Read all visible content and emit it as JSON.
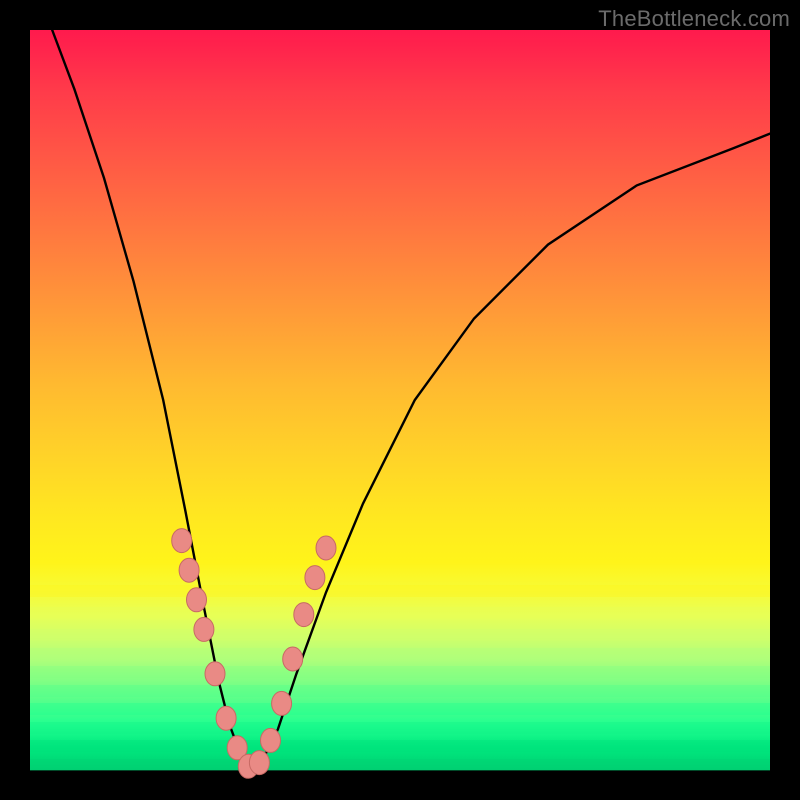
{
  "watermark": "TheBottleneck.com",
  "colors": {
    "frame": "#000000",
    "curve": "#000000",
    "marker_fill": "#e98a85",
    "marker_stroke": "#c76a64"
  },
  "chart_data": {
    "type": "line",
    "title": "",
    "xlabel": "",
    "ylabel": "",
    "xlim": [
      0,
      1
    ],
    "ylim": [
      0,
      1
    ],
    "grid": false,
    "legend": false,
    "series": [
      {
        "name": "bottleneck-curve",
        "x": [
          0.03,
          0.06,
          0.1,
          0.14,
          0.18,
          0.21,
          0.235,
          0.255,
          0.27,
          0.285,
          0.3,
          0.315,
          0.335,
          0.36,
          0.4,
          0.45,
          0.52,
          0.6,
          0.7,
          0.82,
          0.95,
          1.0
        ],
        "y": [
          1.0,
          0.92,
          0.8,
          0.66,
          0.5,
          0.35,
          0.22,
          0.12,
          0.06,
          0.02,
          0.0,
          0.015,
          0.055,
          0.13,
          0.24,
          0.36,
          0.5,
          0.61,
          0.71,
          0.79,
          0.84,
          0.86
        ]
      }
    ],
    "markers": {
      "name": "highlighted-points",
      "x": [
        0.205,
        0.215,
        0.225,
        0.235,
        0.25,
        0.265,
        0.28,
        0.295,
        0.31,
        0.325,
        0.34,
        0.355,
        0.37,
        0.385,
        0.4
      ],
      "y": [
        0.31,
        0.27,
        0.23,
        0.19,
        0.13,
        0.07,
        0.03,
        0.005,
        0.01,
        0.04,
        0.09,
        0.15,
        0.21,
        0.26,
        0.3
      ]
    },
    "bands": [
      {
        "offset": 0.75,
        "color": "#fff41a"
      },
      {
        "offset": 0.78,
        "color": "#e8ff55"
      },
      {
        "offset": 0.81,
        "color": "#d0ff6a"
      },
      {
        "offset": 0.835,
        "color": "#b0ff7a"
      },
      {
        "offset": 0.86,
        "color": "#80ff84"
      },
      {
        "offset": 0.885,
        "color": "#50ff8c"
      },
      {
        "offset": 0.91,
        "color": "#20ff90"
      },
      {
        "offset": 0.935,
        "color": "#10f088"
      },
      {
        "offset": 0.96,
        "color": "#00e07c"
      },
      {
        "offset": 0.985,
        "color": "#00d072"
      }
    ]
  }
}
